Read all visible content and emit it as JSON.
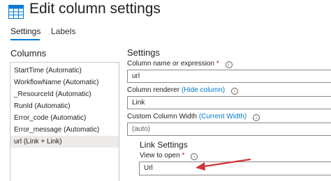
{
  "header": {
    "title": "Edit column settings",
    "icon": "table-icon"
  },
  "tabs": [
    {
      "label": "Settings",
      "active": true
    },
    {
      "label": "Labels",
      "active": false
    }
  ],
  "columns": {
    "heading": "Columns",
    "items": [
      "StartTime (Automatic)",
      "WorkflowName (Automatic)",
      "_ResourceId (Automatic)",
      "RunId (Automatic)",
      "Error_code (Automatic)",
      "Error_message (Automatic)",
      "url (Link + Link)"
    ],
    "selected_index": 6
  },
  "settings": {
    "heading": "Settings",
    "column_name": {
      "label": "Column name or expression",
      "required_mark": "*",
      "value": "url"
    },
    "renderer": {
      "label": "Column renderer",
      "link_text": "(Hide column)",
      "value": "Link"
    },
    "width": {
      "label": "Custom Column Width",
      "link_text": "(Current Width)",
      "value": "(auto)"
    },
    "link_settings": {
      "heading": "Link Settings",
      "view_to_open": {
        "label": "View to open",
        "required_mark": "*",
        "value": "Url"
      }
    }
  },
  "colors": {
    "accent": "#0078d4",
    "required": "#a4262c",
    "annotation_arrow": "#d13438"
  }
}
